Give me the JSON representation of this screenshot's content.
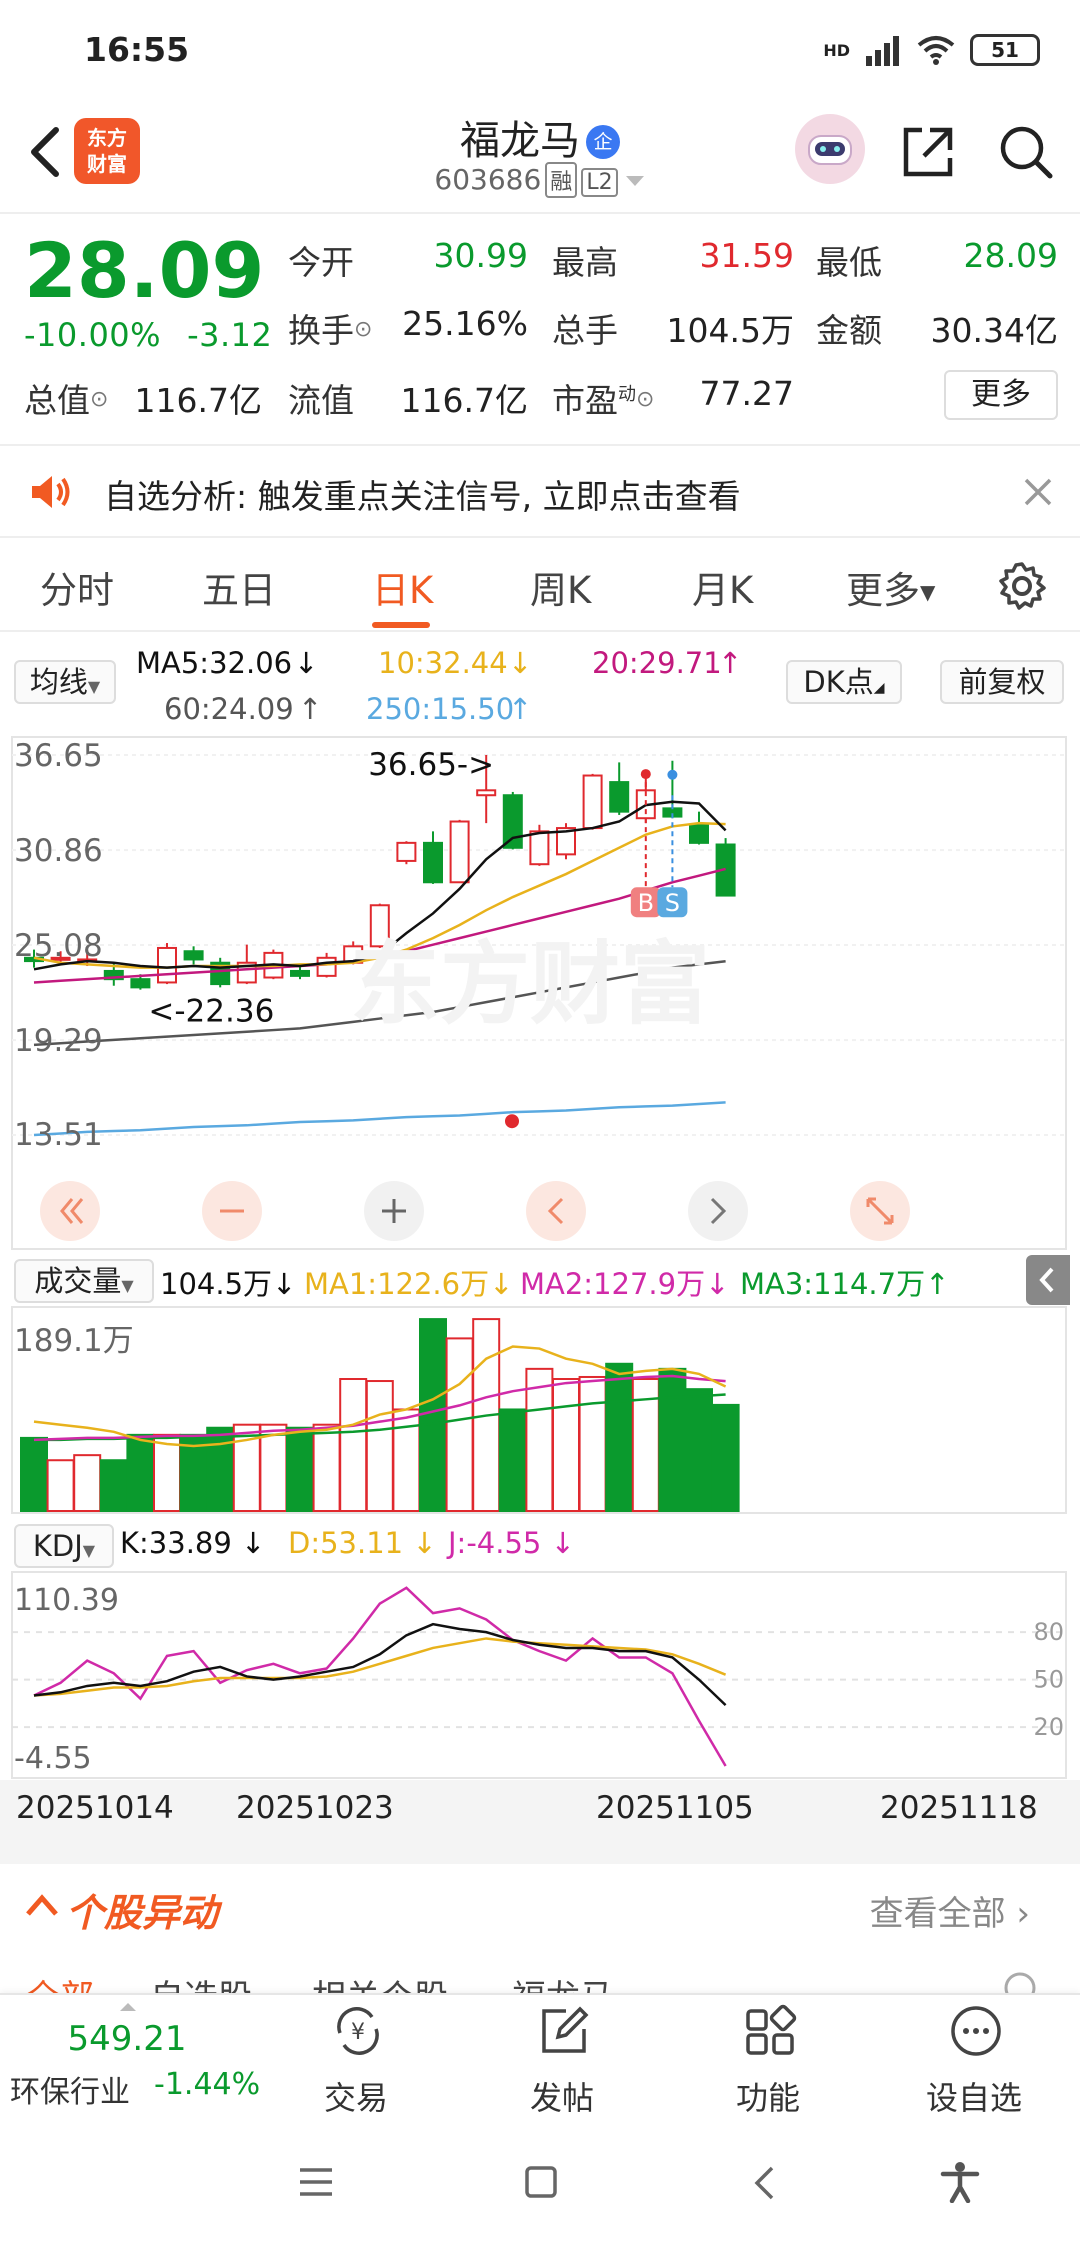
{
  "status": {
    "time": "16:55",
    "network": "HD",
    "battery": "51"
  },
  "header": {
    "logo_line1": "东方",
    "logo_line2": "财富",
    "stock_name": "福龙马",
    "enterprise_badge": "企",
    "stock_code": "603686",
    "tag_margin": "融",
    "tag_level": "L2"
  },
  "quote": {
    "price": "28.09",
    "change_pct": "-10.00%",
    "change_abs": "-3.12",
    "open_label": "今开",
    "open": "30.99",
    "high_label": "最高",
    "high": "31.59",
    "low_label": "最低",
    "low": "28.09",
    "turnover_label": "换手",
    "turnover": "25.16%",
    "volume_label": "总手",
    "volume": "104.5万",
    "amount_label": "金额",
    "amount": "30.34亿",
    "mktcap_label": "总值",
    "mktcap": "116.7亿",
    "float_label": "流值",
    "float_cap": "116.7亿",
    "pe_label": "市盈",
    "pe_sup": "动",
    "pe": "77.27",
    "more": "更多"
  },
  "notice": {
    "text": "自选分析: 触发重点关注信号, 立即点击查看"
  },
  "tabs": [
    "分时",
    "五日",
    "日K",
    "周K",
    "月K",
    "更多"
  ],
  "active_tab": "日K",
  "ma_legend": {
    "selector": "均线",
    "ma5": "MA5:32.06",
    "ma10": "10:32.44",
    "ma20": "20:29.71",
    "ma60": "60:24.09",
    "ma250": "250:15.50",
    "dk": "DK点",
    "fq": "前复权"
  },
  "kline": {
    "y_labels": [
      "36.65",
      "30.86",
      "25.08",
      "19.29",
      "13.51"
    ],
    "max_note": "36.65->",
    "min_note": "<-22.36",
    "buy_mark": "B",
    "sell_mark": "S"
  },
  "volume": {
    "selector": "成交量",
    "value": "104.5万",
    "ma1": "MA1:122.6万",
    "ma2": "MA2:127.9万",
    "ma3": "MA3:114.7万",
    "max_label": "189.1万"
  },
  "kdj": {
    "selector": "KDJ",
    "k": "K:33.89",
    "d": "D:53.11",
    "j": "J:-4.55",
    "top": "110.39",
    "bottom": "-4.55",
    "levels": [
      "80",
      "50",
      "20"
    ]
  },
  "dates": [
    "20251014",
    "20251023",
    "20251105",
    "20251118"
  ],
  "abnormal": {
    "title": "个股异动",
    "view_all": "查看全部"
  },
  "subtabs": [
    "全部",
    "自选股",
    "相关个股",
    "福龙马"
  ],
  "bottom_nav": {
    "index_value": "549.21",
    "index_name": "环保行业",
    "index_change": "-1.44%",
    "items": [
      "交易",
      "发帖",
      "功能",
      "设自选"
    ]
  },
  "colors": {
    "up": "#e0292e",
    "down": "#0a9a2d",
    "accent": "#f15a22",
    "ma5": "#111111",
    "ma10": "#e8b21c",
    "ma20": "#c2197e",
    "ma60": "#555555",
    "ma250": "#5aa9e0"
  },
  "chart_data": {
    "type": "candlestick",
    "dates_shown": [
      "20251014",
      "20251023",
      "20251105",
      "20251118"
    ],
    "ylim": [
      13.51,
      36.65
    ],
    "candles": [
      {
        "o": 24.3,
        "c": 24.1,
        "h": 24.8,
        "l": 23.7
      },
      {
        "o": 24.2,
        "c": 24.3,
        "h": 24.7,
        "l": 23.9
      },
      {
        "o": 24.1,
        "c": 24.2,
        "h": 24.6,
        "l": 23.8
      },
      {
        "o": 23.5,
        "c": 23.0,
        "h": 24.0,
        "l": 22.6
      },
      {
        "o": 23.0,
        "c": 22.5,
        "h": 23.3,
        "l": 22.36
      },
      {
        "o": 22.8,
        "c": 24.9,
        "h": 25.2,
        "l": 22.7
      },
      {
        "o": 24.7,
        "c": 24.2,
        "h": 25.0,
        "l": 23.9
      },
      {
        "o": 24.0,
        "c": 22.7,
        "h": 24.3,
        "l": 22.5
      },
      {
        "o": 22.8,
        "c": 24.0,
        "h": 25.1,
        "l": 22.7
      },
      {
        "o": 23.1,
        "c": 24.6,
        "h": 24.8,
        "l": 23.0
      },
      {
        "o": 23.5,
        "c": 23.2,
        "h": 23.9,
        "l": 23.0
      },
      {
        "o": 23.2,
        "c": 24.3,
        "h": 24.6,
        "l": 23.1
      },
      {
        "o": 24.0,
        "c": 25.0,
        "h": 25.3,
        "l": 23.9
      },
      {
        "o": 25.0,
        "c": 27.5,
        "h": 27.6,
        "l": 24.9
      },
      {
        "o": 30.2,
        "c": 31.3,
        "h": 31.4,
        "l": 30.0
      },
      {
        "o": 31.3,
        "c": 28.9,
        "h": 32.0,
        "l": 28.8
      },
      {
        "o": 28.9,
        "c": 32.6,
        "h": 32.7,
        "l": 28.9
      },
      {
        "o": 34.2,
        "c": 34.5,
        "h": 36.65,
        "l": 32.5
      },
      {
        "o": 34.2,
        "c": 31.0,
        "h": 34.4,
        "l": 30.9
      },
      {
        "o": 30.0,
        "c": 32.0,
        "h": 32.4,
        "l": 29.9
      },
      {
        "o": 30.6,
        "c": 32.2,
        "h": 32.5,
        "l": 30.3
      },
      {
        "o": 32.2,
        "c": 35.4,
        "h": 35.5,
        "l": 32.1
      },
      {
        "o": 35.0,
        "c": 33.2,
        "h": 36.2,
        "l": 33.0
      },
      {
        "o": 32.8,
        "c": 34.5,
        "h": 35.4,
        "l": 32.5
      },
      {
        "o": 33.4,
        "c": 32.9,
        "h": 36.3,
        "l": 32.8
      },
      {
        "o": 32.4,
        "c": 31.3,
        "h": 33.2,
        "l": 31.2
      },
      {
        "o": 31.2,
        "c": 28.09,
        "h": 31.59,
        "l": 28.09
      }
    ],
    "ma5": [
      23.6,
      23.9,
      24.1,
      24.0,
      23.8,
      23.7,
      23.8,
      23.7,
      23.8,
      23.9,
      23.8,
      24.0,
      24.1,
      24.5,
      25.8,
      27.0,
      28.5,
      30.3,
      31.6,
      31.9,
      32.0,
      32.2,
      32.6,
      33.6,
      33.8,
      33.7,
      32.06
    ],
    "ma10": [
      24.3,
      24.0,
      23.9,
      23.8,
      23.7,
      23.7,
      23.8,
      23.8,
      23.8,
      23.8,
      23.9,
      23.9,
      24.0,
      24.3,
      24.8,
      25.5,
      26.3,
      27.2,
      28.0,
      28.7,
      29.4,
      30.2,
      31.0,
      31.8,
      32.3,
      32.5,
      32.44
    ],
    "ma20": [
      22.8,
      22.9,
      23.0,
      23.1,
      23.2,
      23.3,
      23.4,
      23.5,
      23.6,
      23.7,
      23.8,
      23.9,
      24.1,
      24.4,
      24.7,
      25.1,
      25.5,
      25.9,
      26.3,
      26.7,
      27.1,
      27.5,
      27.9,
      28.4,
      28.9,
      29.3,
      29.71
    ],
    "ma60": [
      19.0,
      19.1,
      19.2,
      19.3,
      19.4,
      19.5,
      19.6,
      19.7,
      19.8,
      19.9,
      20.0,
      20.2,
      20.4,
      20.6,
      20.8,
      21.0,
      21.3,
      21.6,
      21.9,
      22.2,
      22.5,
      22.8,
      23.1,
      23.4,
      23.7,
      23.9,
      24.09
    ],
    "ma250": [
      13.51,
      13.6,
      13.7,
      13.75,
      13.8,
      13.9,
      14.0,
      14.05,
      14.1,
      14.2,
      14.3,
      14.35,
      14.4,
      14.5,
      14.6,
      14.65,
      14.7,
      14.8,
      14.9,
      14.95,
      15.0,
      15.1,
      15.2,
      15.25,
      15.3,
      15.4,
      15.5
    ],
    "volume": {
      "max": 189.1,
      "values": [
        72,
        50,
        55,
        50,
        75,
        75,
        75,
        82,
        85,
        85,
        82,
        85,
        130,
        128,
        100,
        189,
        170,
        189,
        100,
        140,
        130,
        132,
        145,
        130,
        140,
        120,
        104.5
      ],
      "ma1": [
        88,
        85,
        82,
        78,
        70,
        66,
        64,
        66,
        70,
        75,
        78,
        80,
        85,
        95,
        100,
        110,
        125,
        150,
        162,
        160,
        150,
        145,
        135,
        138,
        140,
        135,
        122.6
      ],
      "ma2": [
        70,
        71,
        72,
        72,
        73,
        74,
        74,
        75,
        77,
        79,
        80,
        82,
        84,
        88,
        92,
        98,
        104,
        112,
        118,
        122,
        126,
        128,
        130,
        132,
        133,
        130,
        127.9
      ],
      "ma3": [
        70,
        70,
        71,
        71,
        72,
        72,
        73,
        73,
        74,
        75,
        76,
        77,
        78,
        80,
        83,
        86,
        90,
        94,
        97,
        100,
        103,
        106,
        108,
        110,
        112,
        113,
        114.7
      ]
    },
    "kdj": {
      "ylim": [
        -4.55,
        110.39
      ],
      "k": [
        40,
        42,
        46,
        48,
        46,
        49,
        55,
        58,
        52,
        50,
        52,
        55,
        58,
        66,
        78,
        85,
        82,
        80,
        75,
        72,
        70,
        70,
        68,
        68,
        64,
        50,
        33.89
      ],
      "d": [
        40,
        41,
        43,
        45,
        45,
        46,
        49,
        51,
        51,
        51,
        51,
        52,
        55,
        60,
        65,
        70,
        73,
        76,
        74,
        73,
        72,
        71,
        70,
        69,
        66,
        60,
        53.11
      ],
      "j": [
        40,
        48,
        62,
        54,
        38,
        65,
        68,
        48,
        56,
        60,
        54,
        57,
        76,
        98,
        108,
        92,
        95,
        88,
        75,
        68,
        62,
        76,
        64,
        64,
        54,
        24,
        -4.55
      ]
    }
  }
}
